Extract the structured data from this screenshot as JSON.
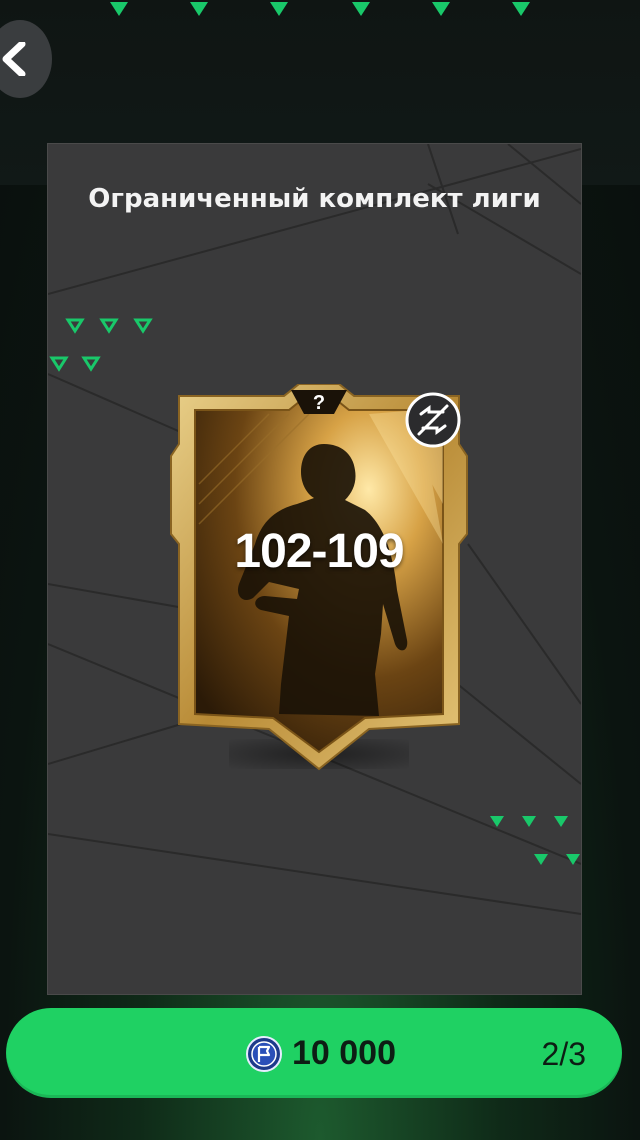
{
  "pack": {
    "title": "Ограниченный комплект лиги",
    "rating_range": "102-109",
    "card_symbol": "?",
    "badge_icon": "untradeable-icon"
  },
  "purchase": {
    "currency_icon": "coin-icon",
    "price": "10 000",
    "count": "2/3"
  },
  "colors": {
    "accent_green": "#1fd163",
    "triangle_green": "#19c86a",
    "card_gold": "#c9a24a"
  }
}
